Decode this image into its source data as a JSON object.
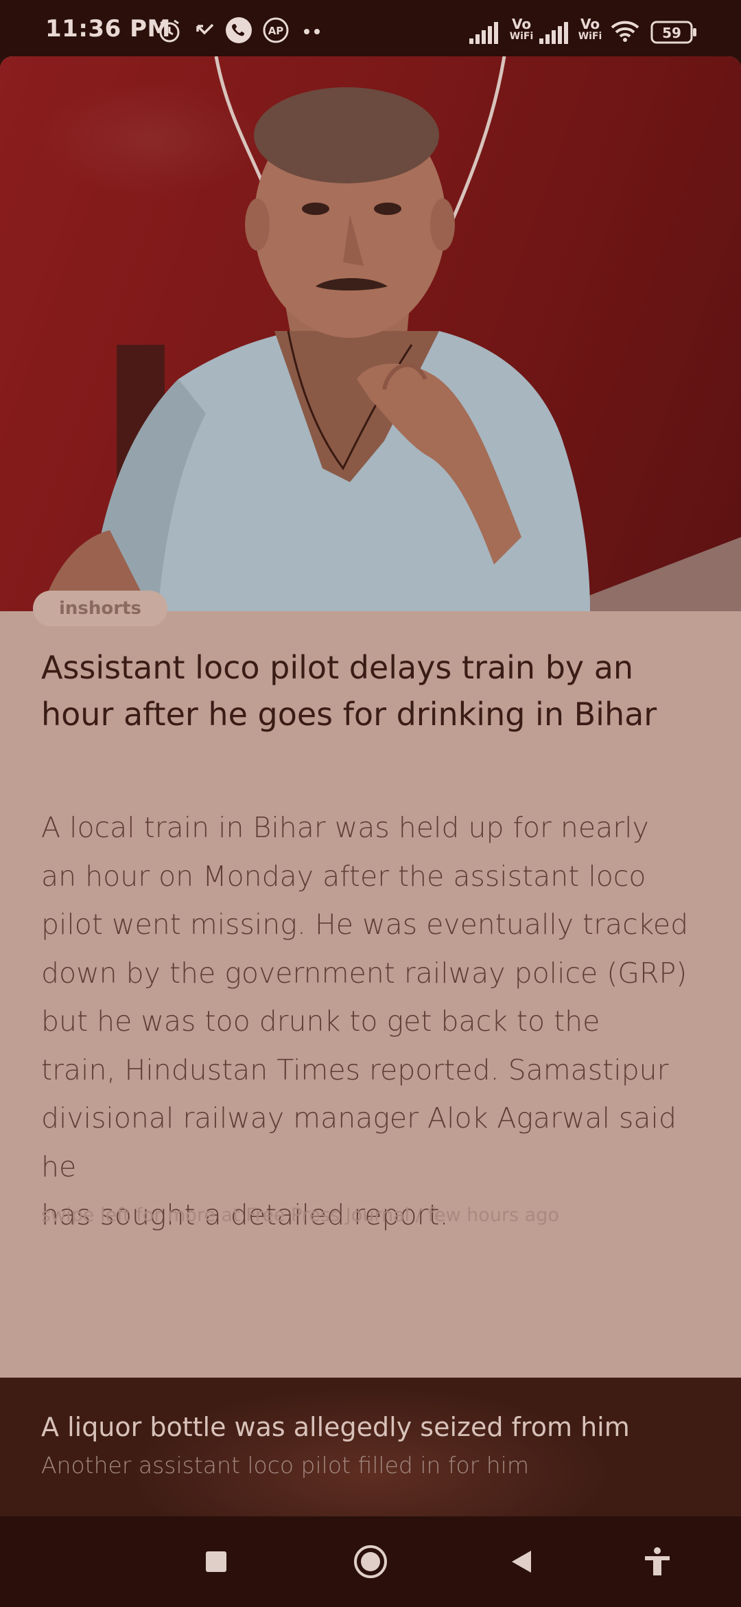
{
  "status_bar": {
    "time": "11:36 PM",
    "battery": "59",
    "network_label_1": "Vo",
    "network_sub_1": "WiFi",
    "network_label_2": "Vo",
    "network_sub_2": "WiFi",
    "app_badge": "AP",
    "icons": [
      "alarm-icon",
      "missed-call-icon",
      "phone-icon",
      "ap-badge-icon",
      "more-dots-icon",
      "signal-icon",
      "vowifi-icon",
      "signal-icon",
      "vowifi-icon",
      "wifi-icon",
      "battery-icon"
    ]
  },
  "article": {
    "source_badge": "inshorts",
    "headline": "Assistant loco pilot delays train by an hour after he goes for drinking in Bihar",
    "body_lines": [
      "A local train in Bihar was held up for nearly",
      "an hour on Monday after the assistant loco",
      "pilot went missing. He was eventually tracked",
      "down by the government railway police (GRP)",
      "but he was too drunk to get back to the",
      "train, Hindustan Times reported. Samastipur",
      "divisional railway manager Alok Agarwal said he",
      "has sought a detailed report."
    ],
    "swipe_hint": "swipe left for more at Free Press Journal / few hours ago"
  },
  "teaser": {
    "title": "A liquor bottle was allegedly seized from him",
    "subtitle": "Another assistant loco pilot filled in for him"
  },
  "nav_bar": {
    "icons": [
      "recents-square-icon",
      "home-circle-icon",
      "back-triangle-icon",
      "accessibility-icon"
    ]
  }
}
